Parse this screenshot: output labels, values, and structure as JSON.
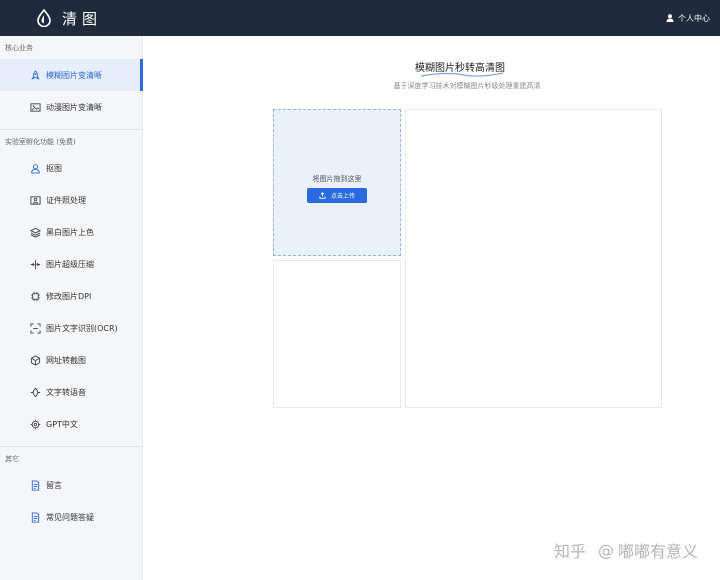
{
  "header": {
    "brand": "清图",
    "user_label": "个人中心"
  },
  "sidebar": {
    "sections": [
      {
        "title": "核心业务"
      },
      {
        "title": "实验室孵化功能 (免费)"
      },
      {
        "title": "其它"
      }
    ],
    "items": [
      {
        "label": "模糊图片变清晰",
        "icon": "rocket-icon"
      },
      {
        "label": "动漫图片变清晰",
        "icon": "image-icon"
      },
      {
        "label": "抠图",
        "icon": "person-icon"
      },
      {
        "label": "证件照处理",
        "icon": "id-photo-icon"
      },
      {
        "label": "黑白图片上色",
        "icon": "layers-icon"
      },
      {
        "label": "图片超级压缩",
        "icon": "compress-icon"
      },
      {
        "label": "修改图片DPI",
        "icon": "chip-icon"
      },
      {
        "label": "图片文字识别(OCR)",
        "icon": "scan-icon"
      },
      {
        "label": "网址转截图",
        "icon": "globe-icon"
      },
      {
        "label": "文字转语音",
        "icon": "sound-icon"
      },
      {
        "label": "GPT中文",
        "icon": "gear-icon"
      },
      {
        "label": "留言",
        "icon": "document-icon"
      },
      {
        "label": "常见问题答疑",
        "icon": "document-icon"
      }
    ]
  },
  "main": {
    "title": "模糊图片秒转高清图",
    "subtitle": "基于深度学习技术对模糊图片秒级处理重建高清",
    "upload_hint": "将图片拖到这里",
    "upload_button": "点击上传"
  },
  "watermark": {
    "left": "知乎",
    "at": "@",
    "right": "嘟嘟有意义"
  },
  "colors": {
    "header_bg": "#1f2a3c",
    "accent": "#2b6be0",
    "sidebar_bg": "#f5f6f8",
    "active_bg": "#e8eef9",
    "upload_bg": "#eaf1fb"
  }
}
